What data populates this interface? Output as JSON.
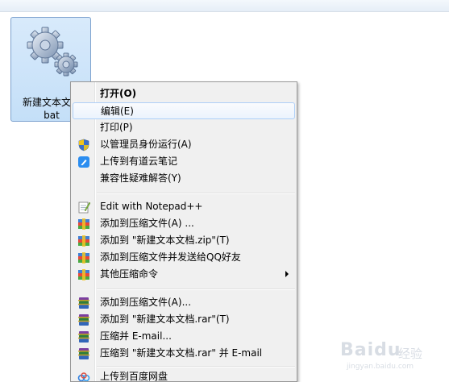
{
  "file": {
    "label_line1": "新建文本文档",
    "label_line2": "bat",
    "icon": "gear-file-icon"
  },
  "menu": {
    "items": [
      {
        "label": "打开(O)",
        "bold": true,
        "icon": ""
      },
      {
        "label": "编辑(E)",
        "highlighted": true,
        "icon": ""
      },
      {
        "label": "打印(P)",
        "icon": ""
      },
      {
        "label": "以管理员身份运行(A)",
        "icon": "shield-icon"
      },
      {
        "label": "上传到有道云笔记",
        "icon": "youdao-icon"
      },
      {
        "label": "兼容性疑难解答(Y)",
        "icon": ""
      },
      {
        "label": "Edit with Notepad++",
        "icon": "notepad-icon"
      },
      {
        "label": "添加到压缩文件(A) ...",
        "icon": "archive-icon"
      },
      {
        "label": "添加到 \"新建文本文档.zip\"(T)",
        "icon": "archive-icon"
      },
      {
        "label": "添加到压缩文件并发送给QQ好友",
        "icon": "archive-icon"
      },
      {
        "label": "其他压缩命令",
        "icon": "archive-icon",
        "submenu": true
      },
      {
        "label": "添加到压缩文件(A)...",
        "icon": "winrar-icon"
      },
      {
        "label": "添加到 \"新建文本文档.rar\"(T)",
        "icon": "winrar-icon"
      },
      {
        "label": "压缩并 E-mail...",
        "icon": "winrar-icon"
      },
      {
        "label": "压缩到 \"新建文本文档.rar\" 并 E-mail",
        "icon": "winrar-icon"
      },
      {
        "label": "上传到百度网盘",
        "icon": "baidu-cloud-icon"
      }
    ]
  },
  "watermark": {
    "brand": "Baidu",
    "sub": "经验",
    "url": "jingyan.baidu.com"
  },
  "colors": {
    "highlight_border": "#aecff7",
    "selection_bg": "#cce4f7",
    "menu_bg": "#f0f0f0"
  }
}
